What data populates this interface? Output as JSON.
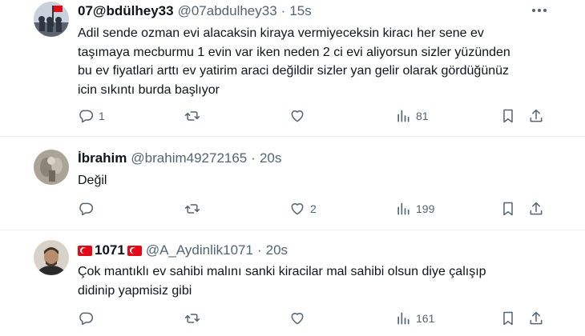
{
  "tweets": [
    {
      "display_name": "07@bdülhey33",
      "handle": "@07abdulhey33",
      "separator": "·",
      "time": "15s",
      "text": "Adil sende ozman evi alacaksin kiraya vermiyeceksin kiracı her sene ev\ntaşımaya mecburmu 1 evin var iken neden 2  ci evi aliyorsun sizler yüzünden\nbu ev fiyatlari arttı ev yatirim araci değildir sizler yan gelir olarak gördüğünüz\nicin sıkıntı burda başlıyor",
      "reply_count": "1",
      "retweet_count": "",
      "like_count": "",
      "view_count": "81"
    },
    {
      "display_name": "İbrahim",
      "handle": "@brahim49272165",
      "separator": "·",
      "time": "20s",
      "text": "Değil",
      "reply_count": "",
      "retweet_count": "",
      "like_count": "2",
      "view_count": "199"
    },
    {
      "display_name": "1071",
      "handle": "@A_Aydinlik1071",
      "separator": "·",
      "time": "20s",
      "text": "Çok mantıklı ev sahibi malını sanki kiracilar mal sahibi olsun diye çalışıp\ndidinip yapmisiz gibi",
      "reply_count": "",
      "retweet_count": "",
      "like_count": "",
      "view_count": "161"
    }
  ],
  "icons": {
    "reply": "reply-icon",
    "retweet": "retweet-icon",
    "like": "like-icon",
    "views": "views-icon",
    "bookmark": "bookmark-icon",
    "share": "share-icon",
    "more": "more-icon",
    "flag": "turkey-flag-icon"
  },
  "colors": {
    "text": "#0f1419",
    "secondary": "#536471",
    "divider": "#eff3f4",
    "flag_red": "#e30a17"
  }
}
